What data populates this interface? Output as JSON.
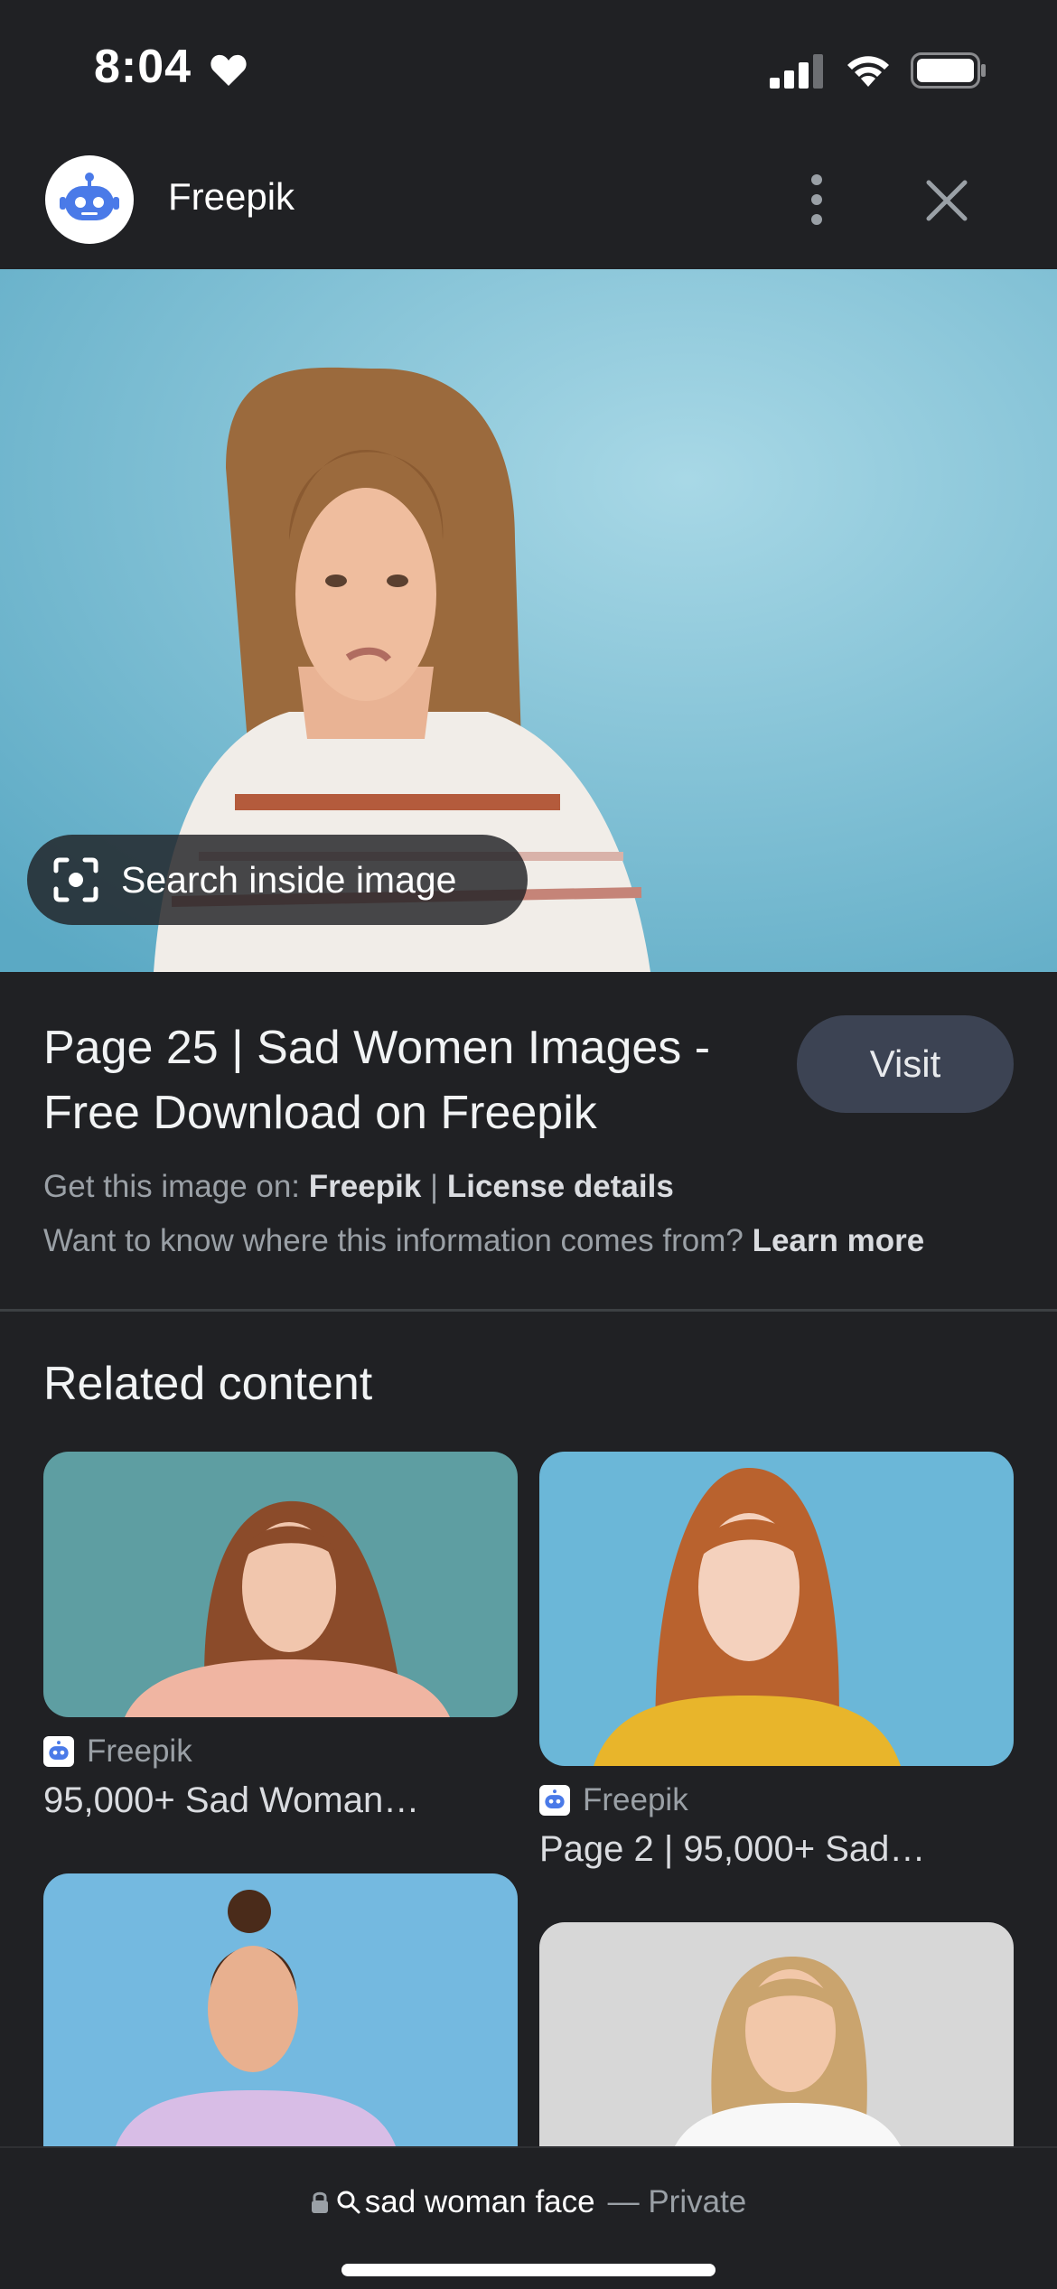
{
  "status": {
    "time": "8:04"
  },
  "topbar": {
    "site_name": "Freepik"
  },
  "hero": {
    "lens_label": "Search inside image"
  },
  "result": {
    "title": "Page 25 | Sad Women Images - Free Download on Freepik",
    "visit_label": "Visit",
    "get_image_prefix": "Get this image on:",
    "get_image_source": "Freepik",
    "separator": "|",
    "license_label": "License details",
    "info_prefix": "Want to know where this information comes from?",
    "learn_more": "Learn more"
  },
  "related": {
    "heading": "Related content",
    "items": [
      {
        "source": "Freepik",
        "caption": "95,000+ Sad Woman…"
      },
      {
        "source": "Freepik",
        "caption": "Page 2 | 95,000+ Sad…"
      },
      {
        "source": "",
        "caption": ""
      },
      {
        "source": "",
        "caption": ""
      }
    ]
  },
  "bottom": {
    "query": "sad woman face",
    "private_label": "— Private"
  },
  "colors": {
    "background": "#202124",
    "visit_button": "#3c4353",
    "accent_blue": "#4a7ae8"
  }
}
